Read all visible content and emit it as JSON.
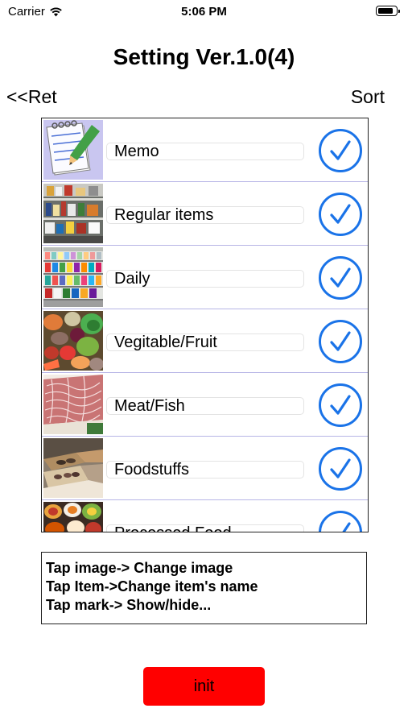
{
  "status_bar": {
    "carrier": "Carrier",
    "time": "5:06 PM",
    "battery_level": 0.9
  },
  "header": {
    "title": "Setting Ver.1.0(4)",
    "back_label": "<<Ret",
    "sort_label": "Sort"
  },
  "colors": {
    "checkmark": "#1a73e8",
    "init_button": "#ff0000",
    "row_divider": "#b7b5e6"
  },
  "items": [
    {
      "label": "Memo",
      "image": "memo-notepad-icon",
      "checked": true
    },
    {
      "label": "Regular items",
      "image": "regular-items-photo",
      "checked": true
    },
    {
      "label": "Daily",
      "image": "daily-goods-shelf-photo",
      "checked": true
    },
    {
      "label": "Vegitable/Fruit",
      "image": "vegetables-photo",
      "checked": true
    },
    {
      "label": "Meat/Fish",
      "image": "meat-photo",
      "checked": true
    },
    {
      "label": "Foodstuffs",
      "image": "foodstuffs-photo",
      "checked": true
    },
    {
      "label": "Processed Food",
      "image": "processed-food-photo",
      "checked": true
    }
  ],
  "help": {
    "line1": "Tap image-> Change image",
    "line2": "Tap Item->Change item's name",
    "line3": "Tap mark-> Show/hide..."
  },
  "init_button": {
    "label": "init"
  }
}
